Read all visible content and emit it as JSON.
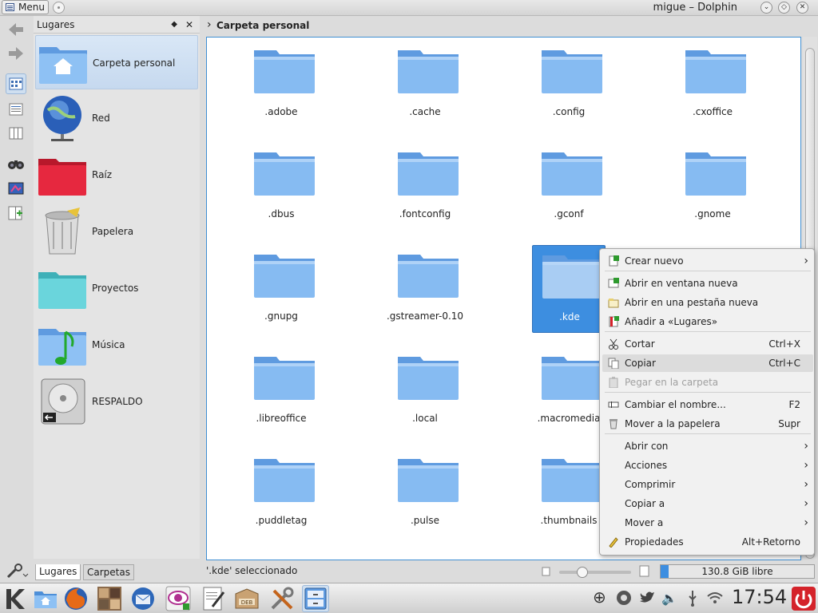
{
  "window": {
    "menu_label": "Menu",
    "title": "migue – Dolphin"
  },
  "places_panel": {
    "title": "Lugares",
    "items": [
      {
        "label": "Carpeta personal",
        "icon": "home-folder-icon"
      },
      {
        "label": "Red",
        "icon": "network-globe-icon"
      },
      {
        "label": "Raíz",
        "icon": "root-folder-icon"
      },
      {
        "label": "Papelera",
        "icon": "trash-icon"
      },
      {
        "label": "Proyectos",
        "icon": "folder-cyan-icon"
      },
      {
        "label": "Música",
        "icon": "music-folder-icon"
      },
      {
        "label": "RESPALDO",
        "icon": "hard-drive-icon"
      }
    ],
    "tabs": [
      "Lugares",
      "Carpetas"
    ]
  },
  "breadcrumb": "Carpeta personal",
  "files": [
    ".adobe",
    ".cache",
    ".config",
    ".cxoffice",
    ".dbus",
    ".fontconfig",
    ".gconf",
    ".gnome",
    ".gnupg",
    ".gstreamer-0.10",
    ".kde",
    "",
    ".libreoffice",
    ".local",
    ".macromedia",
    "",
    ".puddletag",
    ".pulse",
    ".thumbnails",
    ""
  ],
  "context_menu": {
    "items": [
      {
        "label": "Crear nuevo",
        "shortcut": "",
        "submenu": true,
        "icon": "new-file-icon"
      },
      {
        "label": "Abrir en ventana nueva",
        "shortcut": "",
        "icon": "new-window-icon"
      },
      {
        "label": "Abrir en una pestaña nueva",
        "shortcut": "",
        "icon": "new-tab-icon"
      },
      {
        "label": "Añadir a «Lugares»",
        "shortcut": "",
        "icon": "bookmark-add-icon"
      },
      {
        "label": "Cortar",
        "shortcut": "Ctrl+X",
        "icon": "scissors-icon"
      },
      {
        "label": "Copiar",
        "shortcut": "Ctrl+C",
        "icon": "copy-icon"
      },
      {
        "label": "Pegar en la carpeta",
        "shortcut": "",
        "icon": "paste-icon"
      },
      {
        "label": "Cambiar el nombre...",
        "shortcut": "F2",
        "icon": "rename-icon"
      },
      {
        "label": "Mover a la papelera",
        "shortcut": "Supr",
        "icon": "trash-small-icon"
      },
      {
        "label": "Abrir con",
        "shortcut": "",
        "submenu": true
      },
      {
        "label": "Acciones",
        "shortcut": "",
        "submenu": true
      },
      {
        "label": "Comprimir",
        "shortcut": "",
        "submenu": true
      },
      {
        "label": "Copiar a",
        "shortcut": "",
        "submenu": true
      },
      {
        "label": "Mover a",
        "shortcut": "",
        "submenu": true
      },
      {
        "label": "Propiedades",
        "shortcut": "Alt+Retorno",
        "icon": "properties-icon"
      }
    ]
  },
  "status": {
    "text": "'.kde' seleccionado",
    "free_space": "130.8 GiB libre",
    "used_fraction": 0.05
  },
  "taskbar": {
    "clock": "17:54"
  },
  "colors": {
    "accent": "#3d8ee0",
    "folder": "#7fb3ec",
    "panel_bg": "#e4e4e4"
  }
}
